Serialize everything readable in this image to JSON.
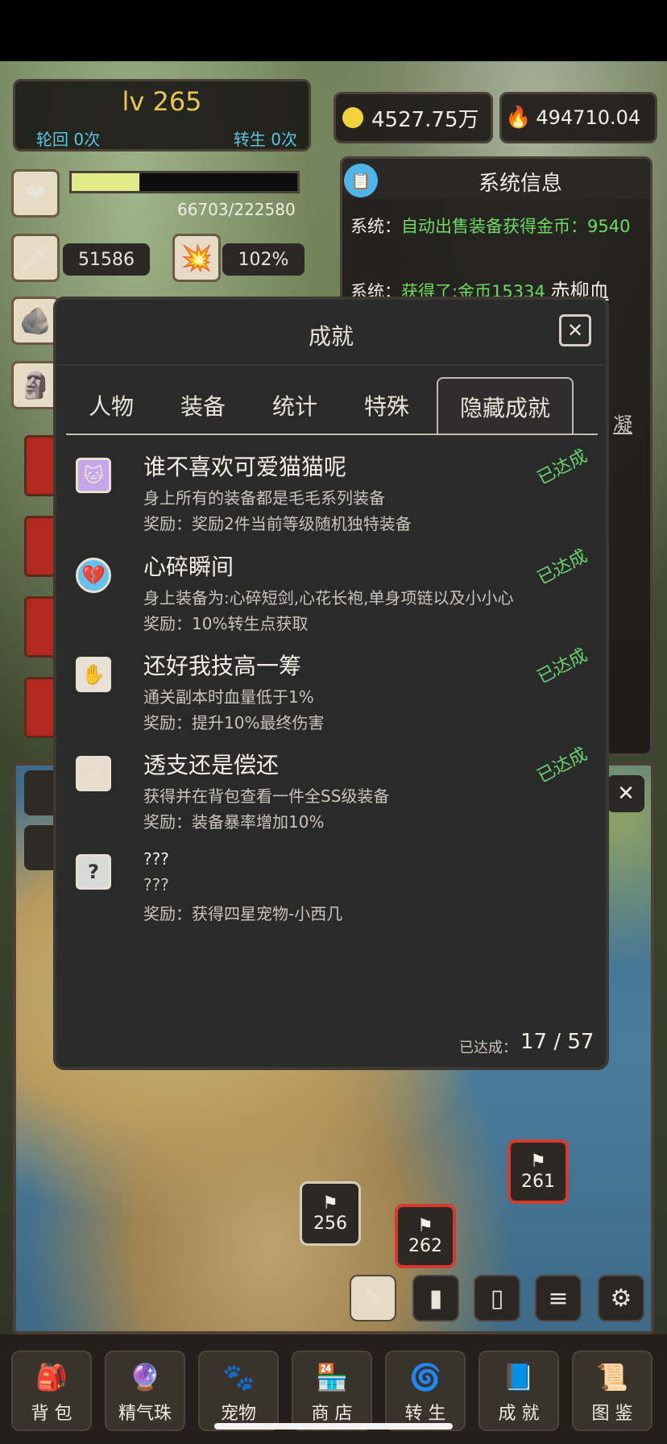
{
  "player": {
    "level": "lv 265",
    "lunhui_label": "轮回 0次",
    "zhuansheng_label": "转生 0次",
    "hp_text": "66703/222580",
    "hp_fraction": 0.3,
    "attack": "51586",
    "crit": "102%"
  },
  "resources": {
    "gold": "4527.75万",
    "fire": "494710.04"
  },
  "system": {
    "title": "系统信息",
    "line1_prefix": "系统：",
    "line1_text": "自动出售装备获得金币：9540",
    "line2_prefix": "系统：",
    "line2_text": "获得了:金币15334",
    "line2_item": "赤柳血",
    "fragment": "凝"
  },
  "modal": {
    "title": "成就",
    "tabs": [
      "人物",
      "装备",
      "统计",
      "特殊",
      "隐藏成就"
    ],
    "active_tab": "隐藏成就",
    "progress_label": "已达成：",
    "progress_value": "17 / 57",
    "achievements": [
      {
        "icon": "cat-icon",
        "title": "谁不喜欢可爱猫猫呢",
        "desc": "身上所有的装备都是毛毛系列装备",
        "reward": "奖励：奖励2件当前等级随机独特装备",
        "status": "已达成"
      },
      {
        "icon": "broken-heart-icon",
        "title": "心碎瞬间",
        "desc": "身上装备为:心碎短剑,心花长袍,单身项链以及小小心",
        "reward": "奖励：10%转生点获取",
        "status": "已达成"
      },
      {
        "icon": "skill-icon",
        "title": "还好我技高一筹",
        "desc": "通关副本时血量低于1%",
        "reward": "奖励：提升10%最终伤害",
        "status": "已达成"
      },
      {
        "icon": "skull-icon",
        "title": "透支还是偿还",
        "desc": "获得并在背包查看一件全SS级装备",
        "reward": "奖励：装备暴率增加10%",
        "status": "已达成"
      },
      {
        "icon": "question-icon",
        "title": "???",
        "desc": "???",
        "reward": "奖励：获得四星宠物-小西几",
        "status": ""
      }
    ]
  },
  "map_flags": [
    {
      "label": "256",
      "style": "dark"
    },
    {
      "label": "262",
      "style": "red"
    },
    {
      "label": "261",
      "style": "red"
    }
  ],
  "toolbar": [
    "edit-icon",
    "chart-icon",
    "book-icon",
    "sliders-icon",
    "gear-icon"
  ],
  "nav": [
    {
      "label": "背 包",
      "icon": "bag-icon"
    },
    {
      "label": "精气珠",
      "icon": "orb-icon"
    },
    {
      "label": "宠物",
      "icon": "pet-icon"
    },
    {
      "label": "商 店",
      "icon": "shop-icon"
    },
    {
      "label": "转 生",
      "icon": "rebirth-icon"
    },
    {
      "label": "成 就",
      "icon": "achievement-icon"
    },
    {
      "label": "图 鉴",
      "icon": "codex-icon"
    }
  ]
}
